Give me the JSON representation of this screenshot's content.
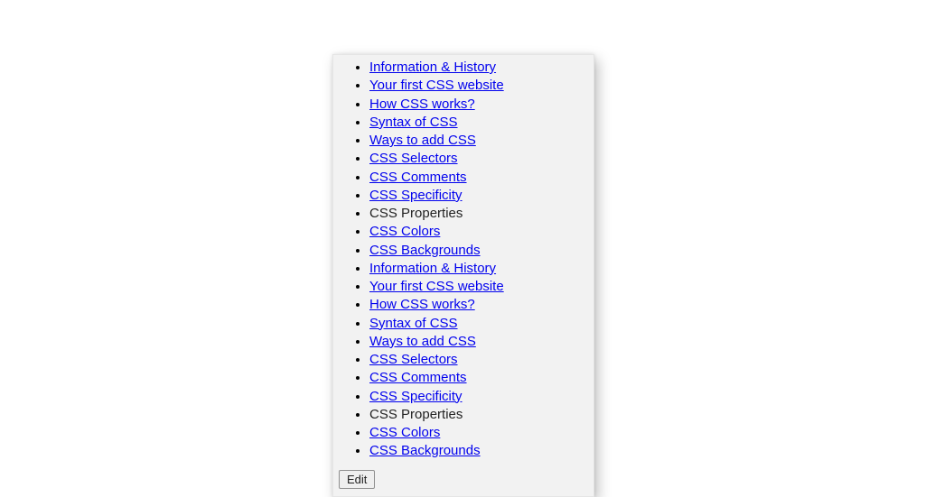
{
  "list": {
    "items": [
      {
        "label": "Information & History",
        "link": true
      },
      {
        "label": "Your first CSS website",
        "link": true
      },
      {
        "label": "How CSS works?",
        "link": true
      },
      {
        "label": "Syntax of CSS",
        "link": true
      },
      {
        "label": "Ways to add CSS",
        "link": true
      },
      {
        "label": "CSS Selectors",
        "link": true
      },
      {
        "label": "CSS Comments",
        "link": true
      },
      {
        "label": "CSS Specificity",
        "link": true
      },
      {
        "label": "CSS Properties",
        "link": false
      },
      {
        "label": "CSS Colors",
        "link": true
      },
      {
        "label": "CSS Backgrounds",
        "link": true
      },
      {
        "label": "Information & History",
        "link": true
      },
      {
        "label": "Your first CSS website",
        "link": true
      },
      {
        "label": "How CSS works?",
        "link": true
      },
      {
        "label": "Syntax of CSS",
        "link": true
      },
      {
        "label": "Ways to add CSS",
        "link": true
      },
      {
        "label": "CSS Selectors",
        "link": true
      },
      {
        "label": "CSS Comments",
        "link": true
      },
      {
        "label": "CSS Specificity",
        "link": true
      },
      {
        "label": "CSS Properties",
        "link": false
      },
      {
        "label": "CSS Colors",
        "link": true
      },
      {
        "label": "CSS Backgrounds",
        "link": true
      }
    ]
  },
  "buttons": {
    "edit": "Edit"
  }
}
